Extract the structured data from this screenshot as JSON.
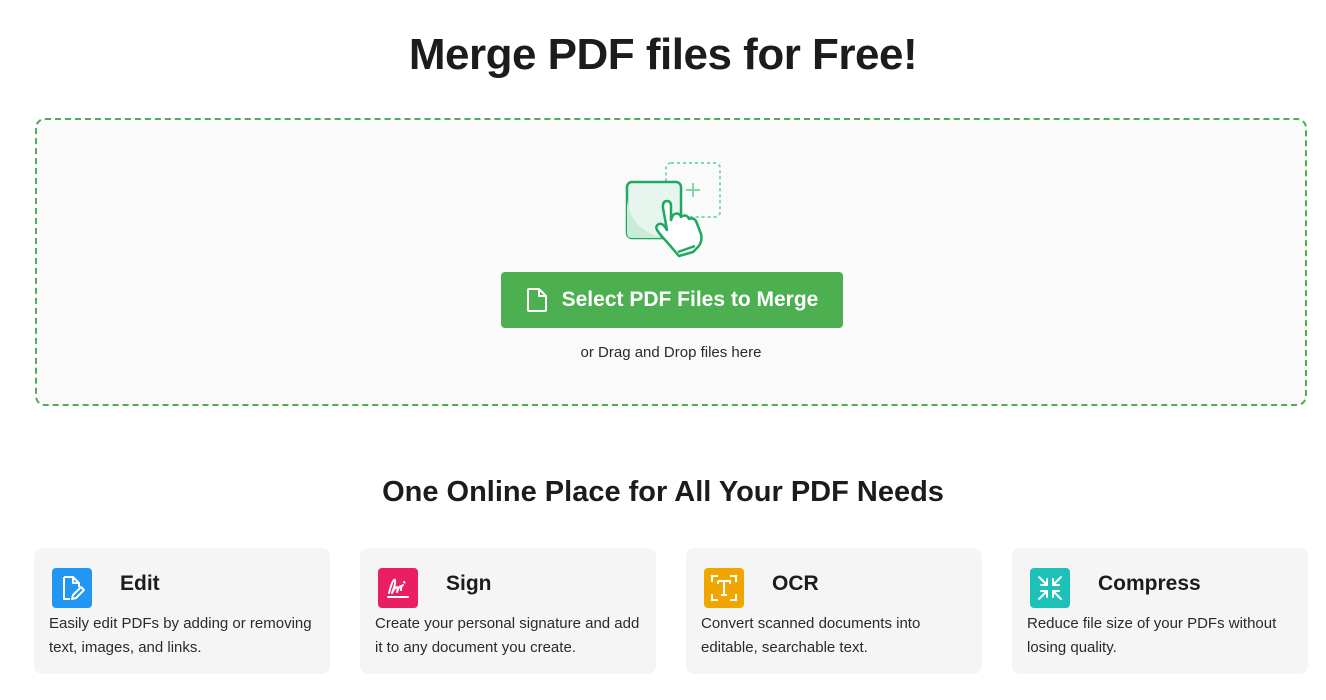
{
  "header": {
    "title": "Merge PDF files for Free!"
  },
  "upload": {
    "button_label": "Select PDF Files to Merge",
    "button_icon": "file-icon",
    "hint": "or Drag and Drop files here",
    "illustration_icon": "hand-tap-add-icon"
  },
  "features_section": {
    "title": "One Online Place for All Your PDF Needs",
    "items": [
      {
        "name": "Edit",
        "icon": "edit-document-icon",
        "color": "#2196f3",
        "description": "Easily edit PDFs by adding or removing text, images, and links."
      },
      {
        "name": "Sign",
        "icon": "signature-icon",
        "color": "#e91e63",
        "description": "Create your personal signature and add it to any document you create."
      },
      {
        "name": "OCR",
        "icon": "ocr-text-icon",
        "color": "#f0a500",
        "description": "Convert scanned documents into editable, searchable text."
      },
      {
        "name": "Compress",
        "icon": "compress-arrows-icon",
        "color": "#1ec1b8",
        "description": "Reduce file size of your PDFs without losing quality."
      }
    ]
  },
  "colors": {
    "accent": "#4caf50",
    "card_bg": "#f5f5f5"
  }
}
